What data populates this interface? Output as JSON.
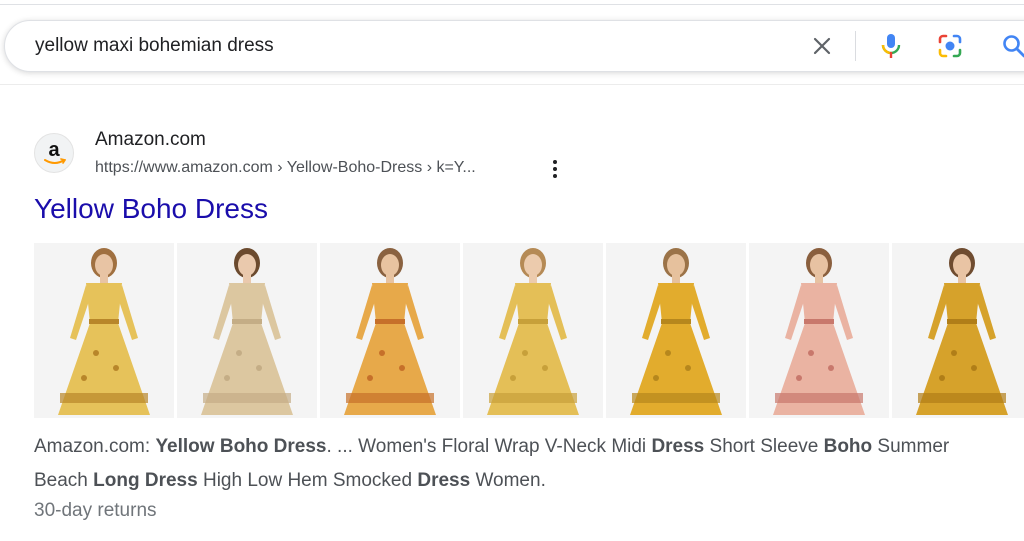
{
  "search": {
    "query": "yellow maxi bohemian dress",
    "clear_icon": "close-icon",
    "voice_icon": "microphone-icon",
    "lens_icon": "camera-lens-icon",
    "search_icon": "magnifier-icon"
  },
  "result": {
    "favicon_letter": "a",
    "site_name": "Amazon.com",
    "url": "https://www.amazon.com › Yellow-Boho-Dress › k=Y...",
    "title": "Yellow Boho Dress",
    "thumbnails": [
      {
        "dress": "#e6c25a",
        "accent": "#b8862a",
        "skin": "#e8c4a4",
        "hair": "#a07040"
      },
      {
        "dress": "#dcc7a0",
        "accent": "#c4ad86",
        "skin": "#eac9ad",
        "hair": "#6b4a2e"
      },
      {
        "dress": "#e7a94a",
        "accent": "#c6702a",
        "skin": "#e8c3a0",
        "hair": "#8a6240"
      },
      {
        "dress": "#e4bf57",
        "accent": "#c7a03a",
        "skin": "#eccbad",
        "hair": "#b58a55"
      },
      {
        "dress": "#e2ac2d",
        "accent": "#b6871d",
        "skin": "#e6c19d",
        "hair": "#9b7348"
      },
      {
        "dress": "#eab3a2",
        "accent": "#c8786c",
        "skin": "#e7c2a2",
        "hair": "#8a5f3e"
      },
      {
        "dress": "#d6a22b",
        "accent": "#b07e18",
        "skin": "#e9c4a4",
        "hair": "#6f4c30"
      }
    ],
    "snippet": {
      "line1": [
        {
          "t": "Amazon.com: ",
          "b": false
        },
        {
          "t": "Yellow Boho Dress",
          "b": true
        },
        {
          "t": ". ... Women's Floral Wrap V-Neck Midi ",
          "b": false
        },
        {
          "t": "Dress",
          "b": true
        },
        {
          "t": " Short Sleeve ",
          "b": false
        },
        {
          "t": "Boho",
          "b": true
        },
        {
          "t": " Summer",
          "b": false
        }
      ],
      "line2": [
        {
          "t": "Beach ",
          "b": false
        },
        {
          "t": "Long Dress",
          "b": true
        },
        {
          "t": " High Low Hem Smocked ",
          "b": false
        },
        {
          "t": "Dress",
          "b": true
        },
        {
          "t": " Women.",
          "b": false
        }
      ]
    },
    "returns": "30-day returns"
  },
  "colors": {
    "link": "#1a0dab",
    "text": "#202124",
    "muted": "#4d5156",
    "mic_blue": "#4285f4",
    "mic_red": "#ea4335",
    "lens_yellow": "#fbbc04",
    "lens_green": "#34a853"
  }
}
